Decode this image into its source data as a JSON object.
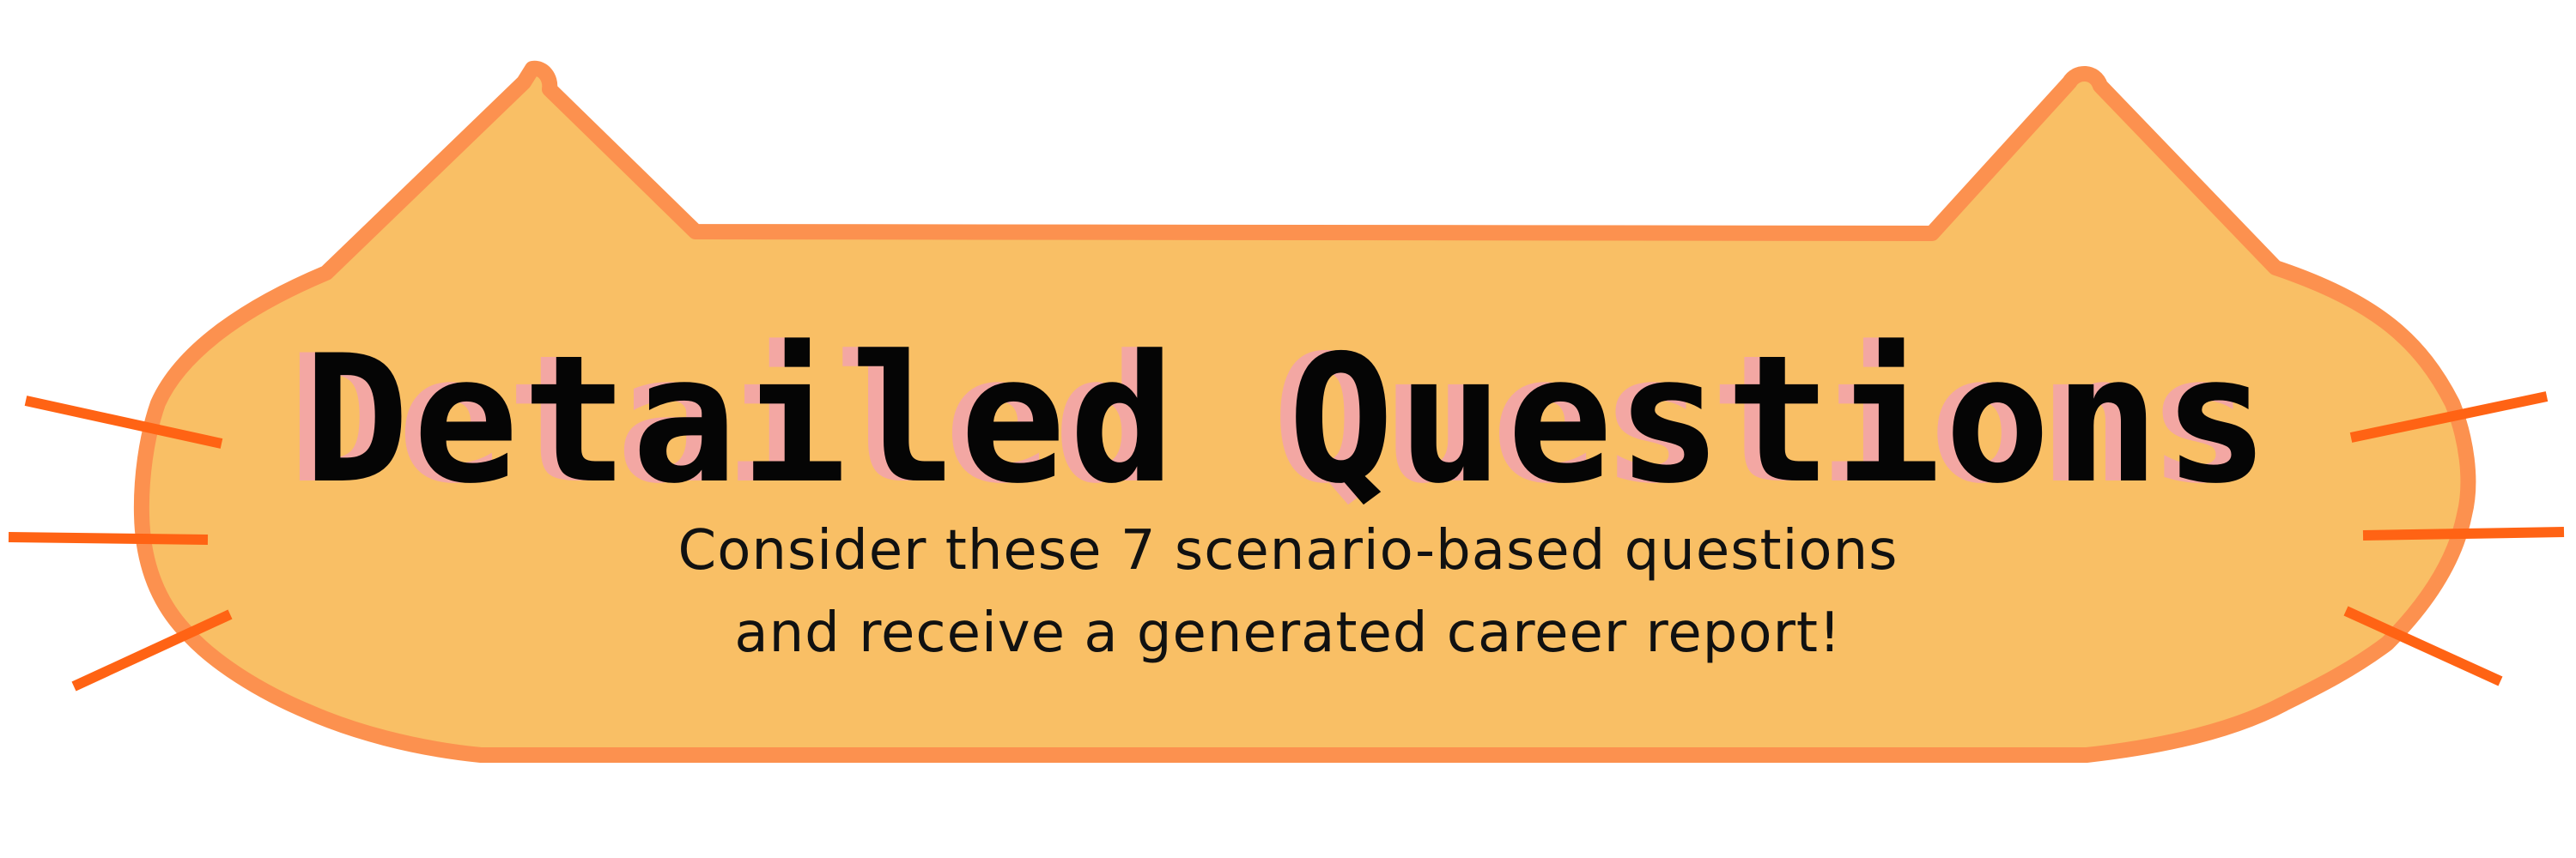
{
  "badge": {
    "title": "Detailed Questions",
    "subtitle_line1": "Consider these 7 scenario-based questions",
    "subtitle_line2": "and receive a generated career report!"
  },
  "colors": {
    "badge_fill": "#f9bf65",
    "badge_outline": "#fc914f",
    "whisker": "#ff6314",
    "title_text": "#050505",
    "title_shadow": "#f3a7a3",
    "subtitle_text": "#111111"
  },
  "icons": {
    "badge_shape": "cat-head-icon",
    "whiskers": "whisker-icon"
  }
}
